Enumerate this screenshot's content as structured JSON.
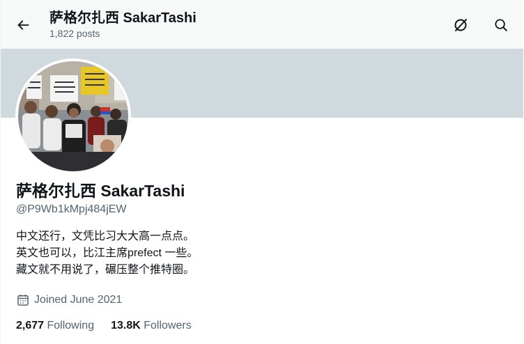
{
  "header": {
    "display_name": "萨格尔扎西 SakarTashi",
    "posts_count": "1,822 posts",
    "back_icon": "arrow-left-icon",
    "grok_icon": "grok-icon",
    "search_icon": "search-icon"
  },
  "profile": {
    "display_name": "萨格尔扎西 SakarTashi",
    "handle": "@P9Wb1kMpj484jEW",
    "bio": [
      "中文还行，文凭比习大大高一点点。",
      "英文也可以，比江主席prefect 一些。",
      "藏文就不用说了，碾压整个推特圈。"
    ],
    "joined": "Joined June 2021",
    "calendar_icon": "calendar-icon",
    "following": {
      "count": "2,677",
      "label": "Following"
    },
    "followers": {
      "count": "13.8K",
      "label": "Followers"
    }
  },
  "colors": {
    "banner": "#cfd9de",
    "header_bg": "#f7f9f9",
    "text_primary": "#0f1419",
    "text_secondary": "#536471"
  }
}
